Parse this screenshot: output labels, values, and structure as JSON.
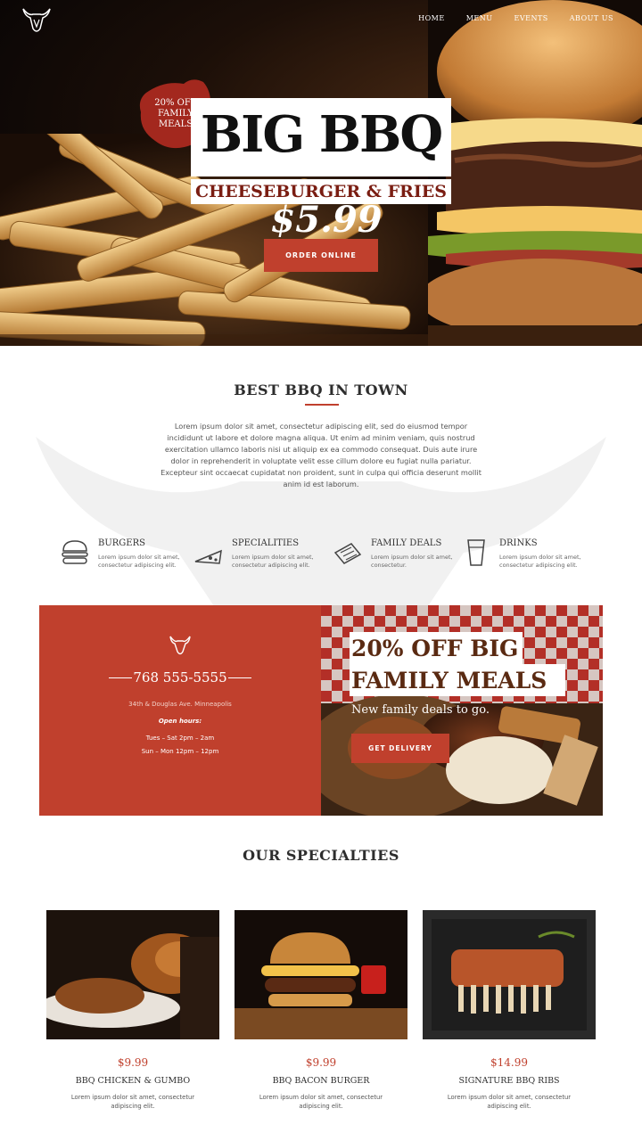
{
  "nav": {
    "items": [
      "HOME",
      "MENU",
      "EVENTS",
      "ABOUT US"
    ]
  },
  "hero": {
    "badge_line1": "20% OFF",
    "badge_line2": "FAMILY",
    "badge_line3": "MEALS",
    "title": "BIG BBQ",
    "subtitle": "CHEESEBURGER & FRIES",
    "price": "$5.99",
    "cta": "ORDER ONLINE"
  },
  "intro": {
    "title": "BEST BBQ IN TOWN",
    "body": "Lorem ipsum dolor sit amet, consectetur adipiscing elit, sed do eiusmod tempor incididunt ut labore et dolore magna aliqua. Ut enim ad minim veniam, quis nostrud exercitation ullamco laboris nisi ut aliquip ex ea commodo consequat. Duis aute irure dolor in reprehenderit in voluptate velit esse cillum dolore eu fugiat nulla pariatur. Excepteur sint occaecat cupidatat non proident, sunt in culpa qui officia deserunt mollit anim id est laborum."
  },
  "features": [
    {
      "title": "BURGERS",
      "icon": "burger-icon",
      "desc": "Lorem ipsum dolor sit amet, consectetur adipiscing elit."
    },
    {
      "title": "SPECIALITIES",
      "icon": "pizza-slice-icon",
      "desc": "Lorem ipsum dolor sit amet, consectetur adipiscing elit."
    },
    {
      "title": "FAMILY DEALS",
      "icon": "food-tray-icon",
      "desc": "Lorem ipsum dolor sit amet, consectetur."
    },
    {
      "title": "DRINKS",
      "icon": "drink-cup-icon",
      "desc": "Lorem ipsum dolor sit amet, consectetur adipiscing elit."
    }
  ],
  "contact": {
    "phone": "768 555-5555",
    "address": "34th & Douglas Ave. Minneapolis",
    "open_label": "Open hours:",
    "hours1": "Tues – Sat  2pm – 2am",
    "hours2": "Sun –  Mon 12pm – 12pm"
  },
  "promo": {
    "title_line1": "20% OFF BIG",
    "title_line2": "FAMILY MEALS",
    "subtitle": "New family deals to go.",
    "cta": "GET DELIVERY"
  },
  "specialties": {
    "title": "OUR SPECIALTIES",
    "items": [
      {
        "price": "$9.99",
        "name": "BBQ CHICKEN & GUMBO",
        "desc": "Lorem ipsum dolor sit amet, consectetur adipiscing elit."
      },
      {
        "price": "$9.99",
        "name": "BBQ BACON BURGER",
        "desc": "Lorem ipsum dolor sit amet, consectetur adipiscing elit."
      },
      {
        "price": "$14.99",
        "name": "SIGNATURE BBQ RIBS",
        "desc": "Lorem ipsum dolor sit amet, consectetur adipiscing elit."
      }
    ]
  },
  "colors": {
    "accent": "#c0402d",
    "dark": "#2d2d2d",
    "hero_bg": "#0a0605"
  }
}
